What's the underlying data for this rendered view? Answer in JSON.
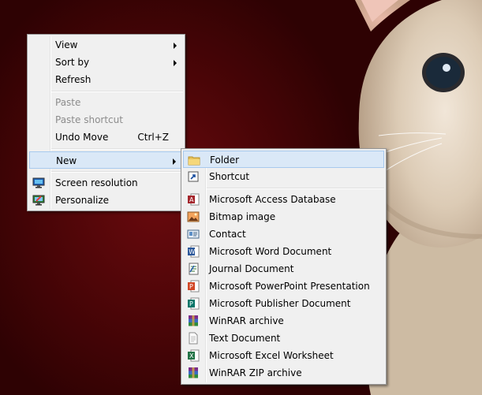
{
  "context_menu": {
    "items": [
      {
        "label": "View",
        "icon": "none",
        "submenu": true
      },
      {
        "label": "Sort by",
        "icon": "none",
        "submenu": true
      },
      {
        "label": "Refresh",
        "icon": "none"
      },
      {
        "label": "Paste",
        "disabled": true
      },
      {
        "label": "Paste shortcut",
        "disabled": true
      },
      {
        "label": "Undo Move",
        "shortcut": "Ctrl+Z"
      },
      {
        "label": "New",
        "submenu": true,
        "highlighted": true
      },
      {
        "label": "Screen resolution",
        "icon": "screen-resolution-icon"
      },
      {
        "label": "Personalize",
        "icon": "personalize-icon"
      }
    ]
  },
  "new_submenu": {
    "items": [
      {
        "label": "Folder",
        "icon": "folder-icon",
        "highlighted": true
      },
      {
        "label": "Shortcut",
        "icon": "shortcut-icon"
      },
      {
        "label": "Microsoft Access Database",
        "icon": "access-icon"
      },
      {
        "label": "Bitmap image",
        "icon": "bitmap-icon"
      },
      {
        "label": "Contact",
        "icon": "contact-icon"
      },
      {
        "label": "Microsoft Word Document",
        "icon": "word-icon"
      },
      {
        "label": "Journal Document",
        "icon": "journal-icon"
      },
      {
        "label": "Microsoft PowerPoint Presentation",
        "icon": "powerpoint-icon"
      },
      {
        "label": "Microsoft Publisher Document",
        "icon": "publisher-icon"
      },
      {
        "label": "WinRAR archive",
        "icon": "winrar-icon"
      },
      {
        "label": "Text Document",
        "icon": "text-document-icon"
      },
      {
        "label": "Microsoft Excel Worksheet",
        "icon": "excel-icon"
      },
      {
        "label": "WinRAR ZIP archive",
        "icon": "winrar-zip-icon"
      }
    ]
  },
  "colors": {
    "menu_bg": "#f0f0f0",
    "highlight_bg": "#dae8f7",
    "highlight_border": "#a7c9ee",
    "disabled_text": "#8c8c8c",
    "wallpaper": "#4a0306"
  }
}
